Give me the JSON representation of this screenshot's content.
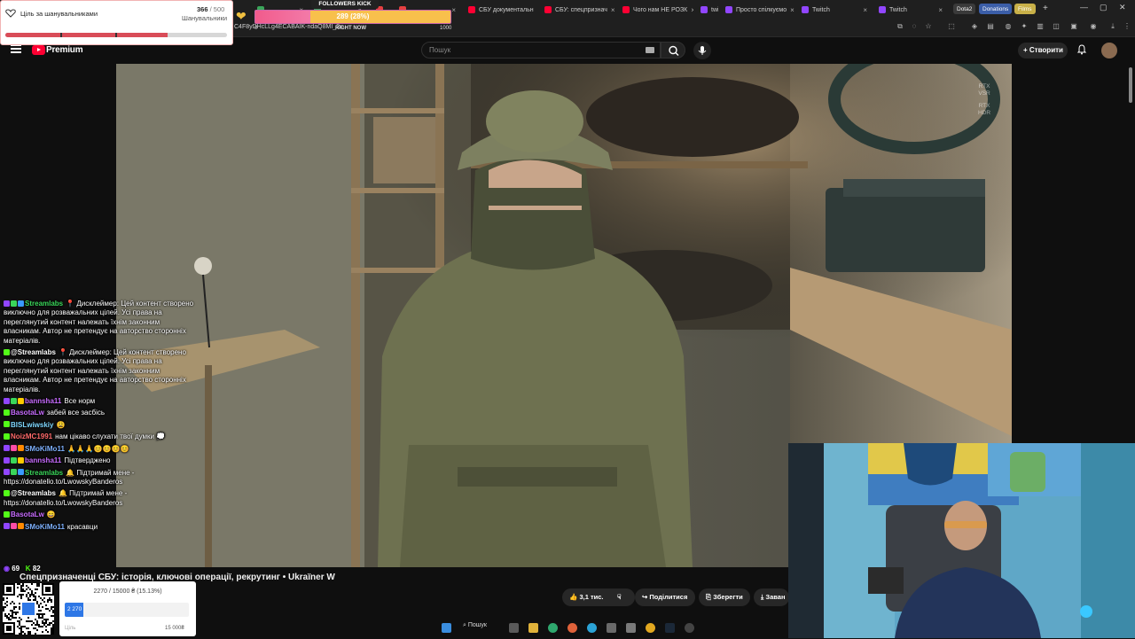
{
  "browser": {
    "tabs": [
      {
        "label": "",
        "color": "#3aa55a"
      },
      {
        "label": "",
        "color": "#3aa55a"
      },
      {
        "label": "",
        "color": "#e64040"
      },
      {
        "label": "",
        "color": "#e64040"
      },
      {
        "label": "СБУ документальн",
        "color": "#ff0033"
      },
      {
        "label": "СБУ: спецпризнач",
        "color": "#ff0033"
      },
      {
        "label": "Чого нам НЕ РОЗК",
        "color": "#ff0033"
      },
      {
        "label": "twitch",
        "color": "#9146ff"
      },
      {
        "label": "Просто спілкуємо",
        "color": "#9146ff"
      },
      {
        "label": "Twitch",
        "color": "#9146ff"
      },
      {
        "label": "Twitch",
        "color": "#9146ff"
      }
    ],
    "pills": [
      {
        "label": "Dota2",
        "color": "#3a3a3a"
      },
      {
        "label": "Donations",
        "color": "#3b5ea8"
      },
      {
        "label": "Films",
        "color": "#c8b048"
      }
    ],
    "new_tab": "+",
    "url": "C4F8yDHcLLg4ECABAIK-ndaQ8MI_2x"
  },
  "youtube": {
    "brand": "Premium",
    "search_placeholder": "Пошук",
    "create_label": "Створити",
    "video_title": "Спецпризначенці СБУ: історія, ключові операції, рекрутинг • Ukraїner W",
    "likes": "3,1 тис.",
    "share": "Поділитися",
    "save": "Зберегти",
    "download": "Заван",
    "rtx_1": "RTX",
    "rtx_2": "VSR",
    "rtx_3": "RTX",
    "rtx_4": "HDR"
  },
  "goal_widget": {
    "title": "Ціль за шанувальниками",
    "count": "366",
    "total": "/ 500",
    "subtitle": "Шанувальники",
    "progress": 0.732
  },
  "followers_kick": {
    "label": "FOLLOWERS KICK",
    "value_text": "289 (28%)",
    "progress": 0.28,
    "min": "0",
    "right_now": "RIGHT NOW",
    "max": "1000"
  },
  "chat": [
    {
      "user": "Streamlabs",
      "color": "#3ad65a",
      "badges": [
        "#9146ff",
        "#3ad65a",
        "#3a9aff"
      ],
      "text": "📍 Дисклеймер: Цей контент створено виключно для розважальних цілей. Усі права на переглянутий контент належать їхнім законним власникам. Автор не претендує на авторство сторонніх матеріалів."
    },
    {
      "user": "@Streamlabs",
      "color": "#ffffff",
      "badges": [
        "#53fc18"
      ],
      "text": "📍 Дисклеймер: Цей контент створено виключно для розважальних цілей. Усі права на переглянутий контент належать їхнім законним власникам. Автор не претендує на авторство сторонніх матеріалів."
    },
    {
      "user": "bannsha11",
      "color": "#c86cff",
      "badges": [
        "#9146ff",
        "#3ad65a",
        "#ffcc00"
      ],
      "text": "Все норм"
    },
    {
      "user": "BasotaLw",
      "color": "#c86cff",
      "badges": [
        "#53fc18"
      ],
      "text": "забей все засбісь"
    },
    {
      "user": "BISLwiwskiy",
      "color": "#7fd7ff",
      "badges": [
        "#53fc18"
      ],
      "text": "😩"
    },
    {
      "user": "NoizMC1991",
      "color": "#ff6a6a",
      "badges": [
        "#53fc18"
      ],
      "text": "нам цікаво слухати твої думки 💭"
    },
    {
      "user": "SMoKiMo11",
      "color": "#7fb2ff",
      "badges": [
        "#9146ff",
        "#ff4da6",
        "#ff8a00"
      ],
      "text": "🙏🙏🙏😊😊😊😊"
    },
    {
      "user": "bannsha11",
      "color": "#c86cff",
      "badges": [
        "#9146ff",
        "#3ad65a",
        "#ffcc00"
      ],
      "text": "Підтверджено"
    },
    {
      "user": "Streamlabs",
      "color": "#3ad65a",
      "badges": [
        "#9146ff",
        "#3ad65a",
        "#3a9aff"
      ],
      "text": "🔔 Підтримай мене - https://donatello.to/LwowskyBanderos"
    },
    {
      "user": "@Streamlabs",
      "color": "#ffffff",
      "badges": [
        "#53fc18"
      ],
      "text": "🔔 Підтримай мене - https://donatello.to/LwowskyBanderos"
    },
    {
      "user": "BasotaLw",
      "color": "#c86cff",
      "badges": [
        "#53fc18"
      ],
      "text": "😄"
    },
    {
      "user": "SMoKiMo11",
      "color": "#7fb2ff",
      "badges": [
        "#9146ff",
        "#ff4da6",
        "#ff8a00"
      ],
      "text": "красавци"
    }
  ],
  "viewers": {
    "twitch": "69",
    "kick": "82"
  },
  "donation": {
    "text": "2270 / 15000 ₴ (15.13%)",
    "value": "2 270",
    "progress": 0.1513,
    "label": "Ціль",
    "max": "15 000₴"
  },
  "taskbar": {
    "search": "Пошук"
  }
}
